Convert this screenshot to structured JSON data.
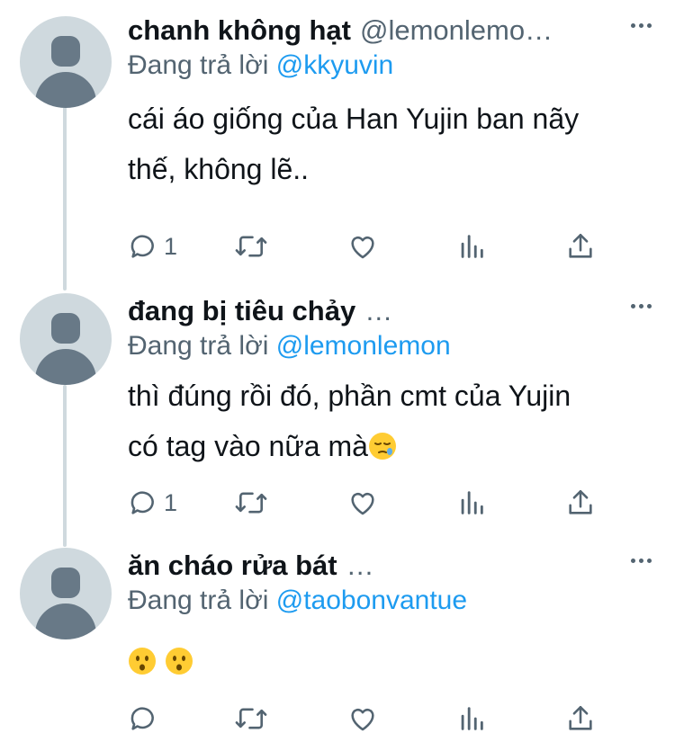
{
  "replies": [
    {
      "display_name": "chanh không hạt",
      "handle": "@lemonlemo…",
      "reply_prefix": "Đang trả lời",
      "reply_to": "@kkyuvin",
      "text_lines": [
        "cái áo giống của Han Yujin ban nãy",
        "thế, không lẽ.."
      ],
      "reply_count": "1",
      "emoji": []
    },
    {
      "display_name": "đang bị tiêu chảy",
      "handle": "…",
      "reply_prefix": "Đang trả lời",
      "reply_to": "@lemonlemon",
      "text_lines": [
        "thì đúng rồi đó, phần cmt của Yujin",
        "có tag vào nữa mà"
      ],
      "reply_count": "1",
      "emoji": [
        "sleepy-face"
      ]
    },
    {
      "display_name": "ăn cháo rửa bát",
      "handle": "…",
      "reply_prefix": "Đang trả lời",
      "reply_to": "@taobonvantue",
      "text_lines": [],
      "reply_count": "",
      "emoji": [
        "hushed-face",
        "hushed-face"
      ]
    }
  ],
  "icons": {
    "reply": "speech-bubble-icon",
    "retweet": "retweet-icon",
    "like": "heart-icon",
    "views": "bar-chart-icon",
    "share": "share-up-arrow-icon",
    "more": "more-dots-icon"
  },
  "colors": {
    "text": "#0f1419",
    "muted": "#536471",
    "link": "#1d9bf0",
    "avatar_bg": "#cfd9de",
    "avatar_fg": "#687987",
    "thread_line": "#cfd9de"
  }
}
